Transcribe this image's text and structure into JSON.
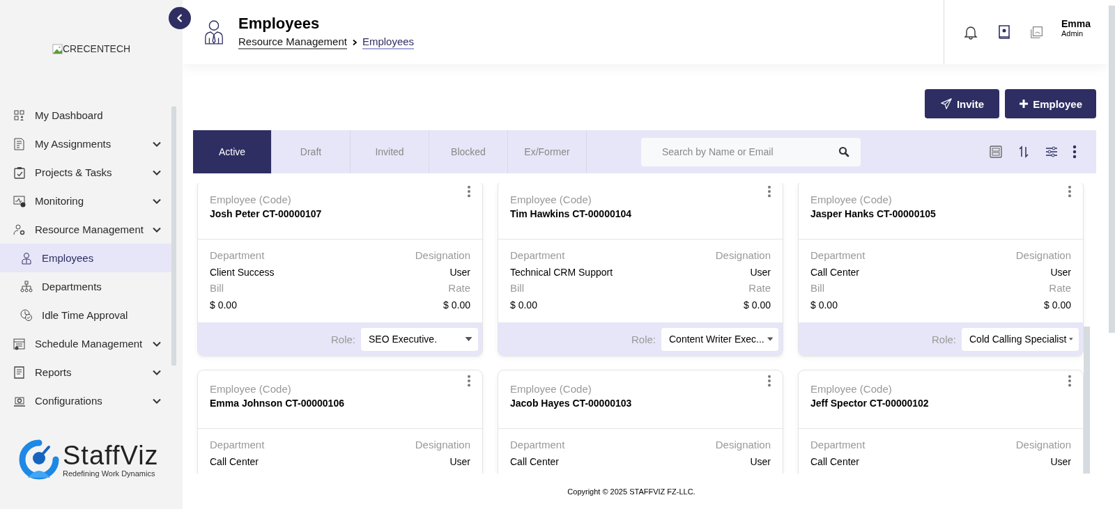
{
  "sidebar": {
    "logo_alt": "CRECENTECH",
    "menu": [
      {
        "label": "My Dashboard",
        "has_submenu": false,
        "selected": false
      },
      {
        "label": "My Assignments",
        "has_submenu": true,
        "selected": false
      },
      {
        "label": "Projects & Tasks",
        "has_submenu": true,
        "selected": false
      },
      {
        "label": "Monitoring",
        "has_submenu": true,
        "selected": false
      },
      {
        "label": "Resource Management",
        "has_submenu": true,
        "selected": false,
        "children": [
          {
            "label": "Employees",
            "selected": true
          },
          {
            "label": "Departments",
            "selected": false
          },
          {
            "label": "Idle Time Approval",
            "selected": false
          }
        ]
      },
      {
        "label": "Schedule Management",
        "has_submenu": true,
        "selected": false
      },
      {
        "label": "Reports",
        "has_submenu": true,
        "selected": false
      },
      {
        "label": "Configurations",
        "has_submenu": true,
        "selected": false
      }
    ],
    "brand": {
      "name": "StaffViz",
      "tagline": "Redefining Work Dynamics"
    }
  },
  "header": {
    "title": "Employees",
    "breadcrumb": [
      {
        "label": "Resource Management",
        "current": false
      },
      {
        "label": "Employees",
        "current": true
      }
    ],
    "user": {
      "name": "Emma",
      "role": "Admin"
    }
  },
  "actions": [
    {
      "kind": "invite",
      "label": "Invite"
    },
    {
      "kind": "add",
      "label": "Employee"
    }
  ],
  "tabs": [
    {
      "label": "Active",
      "selected": true
    },
    {
      "label": "Draft",
      "selected": false
    },
    {
      "label": "Invited",
      "selected": false
    },
    {
      "label": "Blocked",
      "selected": false
    },
    {
      "label": "Ex/Former",
      "selected": false
    }
  ],
  "search": {
    "placeholder": "Search by Name or Email"
  },
  "cards": [
    {
      "name_label": "Employee (Code)",
      "name": "Josh Peter CT-00000107",
      "department_label": "Department",
      "department": "Client Success",
      "designation_label": "Designation",
      "designation": "User",
      "bill_label": "Bill",
      "bill": "$ 0.00",
      "rate_label": "Rate",
      "rate": "$ 0.00",
      "role_label": "Role:",
      "role": "SEO Executive."
    },
    {
      "name_label": "Employee (Code)",
      "name": "Tim Hawkins CT-00000104",
      "department_label": "Department",
      "department": "Technical CRM Support",
      "designation_label": "Designation",
      "designation": "User",
      "bill_label": "Bill",
      "bill": "$ 0.00",
      "rate_label": "Rate",
      "rate": "$ 0.00",
      "role_label": "Role:",
      "role": "Content Writer Exec..."
    },
    {
      "name_label": "Employee (Code)",
      "name": "Jasper Hanks CT-00000105",
      "department_label": "Department",
      "department": "Call Center",
      "designation_label": "Designation",
      "designation": "User",
      "bill_label": "Bill",
      "bill": "$ 0.00",
      "rate_label": "Rate",
      "rate": "$ 0.00",
      "role_label": "Role:",
      "role": "Cold Calling Specialist"
    },
    {
      "name_label": "Employee (Code)",
      "name": "Emma Johnson CT-00000106",
      "department_label": "Department",
      "department": "Call Center",
      "designation_label": "Designation",
      "designation": "User"
    },
    {
      "name_label": "Employee (Code)",
      "name": "Jacob Hayes CT-00000103",
      "department_label": "Department",
      "department": "Call Center",
      "designation_label": "Designation",
      "designation": "User"
    },
    {
      "name_label": "Employee (Code)",
      "name": "Jeff Spector CT-00000102",
      "department_label": "Department",
      "department": "Call Center",
      "designation_label": "Designation",
      "designation": "User"
    }
  ],
  "footer": {
    "copyright": "Copyright © 2025 STAFFVIZ FZ-LLC."
  }
}
